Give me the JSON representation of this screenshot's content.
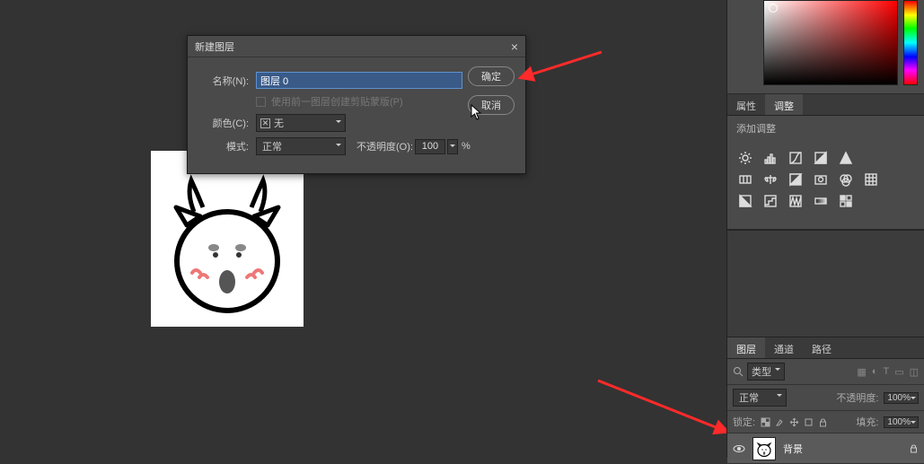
{
  "dialog": {
    "title": "新建图层",
    "name_label": "名称(N):",
    "name_value": "图层 0",
    "clip_label": "使用前一图层创建剪贴蒙版(P)",
    "color_label": "颜色(C):",
    "color_value": "无",
    "mode_label": "模式:",
    "mode_value": "正常",
    "opacity_label": "不透明度(O):",
    "opacity_value": "100",
    "opacity_suffix": "%",
    "ok": "确定",
    "cancel": "取消"
  },
  "props": {
    "tab_props": "属性",
    "tab_adjust": "调整",
    "subtitle": "添加调整"
  },
  "layers": {
    "tab_layers": "图层",
    "tab_channels": "通道",
    "tab_paths": "路径",
    "kind": "类型",
    "blend": "正常",
    "opacity_label": "不透明度:",
    "opacity_value": "100%",
    "lock_label": "锁定:",
    "fill_label": "填充:",
    "fill_value": "100%",
    "layer_name": "背景"
  }
}
